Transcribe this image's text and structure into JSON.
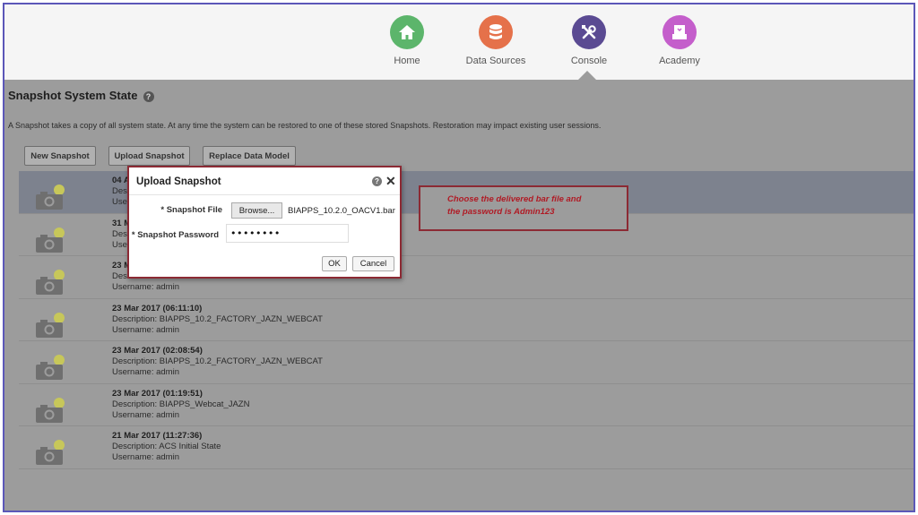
{
  "nav": {
    "items": [
      {
        "label": "Home",
        "icon": "home-icon",
        "color": "#5cb56b"
      },
      {
        "label": "Data Sources",
        "icon": "database-icon",
        "color": "#e5714a"
      },
      {
        "label": "Console",
        "icon": "tools-icon",
        "color": "#5a4a92"
      },
      {
        "label": "Academy",
        "icon": "academy-icon",
        "color": "#c45ecb"
      }
    ],
    "active": "Console"
  },
  "page": {
    "title": "Snapshot System State",
    "description": "A Snapshot takes a copy of all system state. At any time the system can be restored to one of these stored Snapshots. Restoration may impact existing user sessions."
  },
  "toolbar": {
    "new_snapshot": "New Snapshot",
    "upload_snapshot": "Upload Snapshot",
    "replace_data_model": "Replace Data Model"
  },
  "snapshots": [
    {
      "date": "04 A",
      "description": "Desc",
      "username": "Use"
    },
    {
      "date": "31 M",
      "description": "Desc",
      "username": "Use"
    },
    {
      "date": "23 M",
      "description": "Desc",
      "username": "Username: admin"
    },
    {
      "date": "23 Mar 2017 (06:11:10)",
      "description": "Description: BIAPPS_10.2_FACTORY_JAZN_WEBCAT",
      "username": "Username: admin"
    },
    {
      "date": "23 Mar 2017 (02:08:54)",
      "description": "Description: BIAPPS_10.2_FACTORY_JAZN_WEBCAT",
      "username": "Username: admin"
    },
    {
      "date": "23 Mar 2017 (01:19:51)",
      "description": "Description: BIAPPS_Webcat_JAZN",
      "username": "Username: admin"
    },
    {
      "date": "21 Mar 2017 (11:27:36)",
      "description": "Description: ACS Initial State",
      "username": "Username: admin"
    }
  ],
  "dialog": {
    "title": "Upload Snapshot",
    "file_label": "* Snapshot File",
    "browse_label": "Browse...",
    "file_name": "BIAPPS_10.2.0_OACV1.bar",
    "password_label": "* Snapshot Password",
    "password_value": "••••••••",
    "ok_label": "OK",
    "cancel_label": "Cancel"
  },
  "annotation": {
    "line1": "Choose the delivered bar file and",
    "line2": "the password is Admin123"
  },
  "colors": {
    "frame": "#5b57b8",
    "callout_border": "#8c2a34",
    "callout_text": "#b01b25",
    "overlay": "#9c9c9c"
  }
}
